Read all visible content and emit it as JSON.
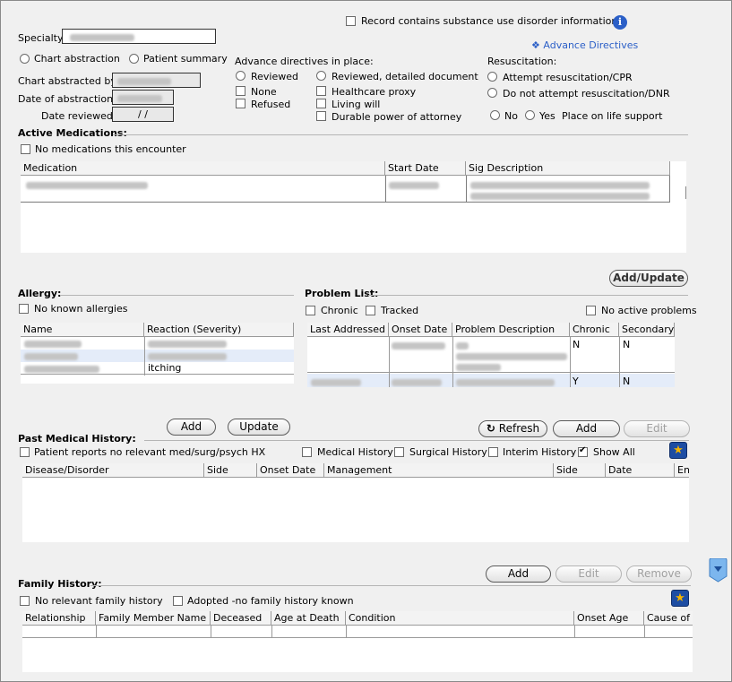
{
  "header": {
    "substance_use_label": "Record contains substance use disorder information",
    "advance_directives_link": "Advance Directives",
    "specialty_label": "Specialty:",
    "chart_abstraction_label": "Chart abstraction",
    "patient_summary_label": "Patient summary",
    "chart_abstracted_by_label": "Chart abstracted by:",
    "date_of_abstraction_label": "Date of abstraction:",
    "date_reviewed_label": "Date reviewed:",
    "date_reviewed_value": "/ /"
  },
  "advance_directives": {
    "title": "Advance directives in place:",
    "reviewed": "Reviewed",
    "reviewed_detailed": "Reviewed, detailed document",
    "none": "None",
    "refused": "Refused",
    "healthcare_proxy": "Healthcare proxy",
    "living_will": "Living will",
    "durable_poa": "Durable power of attorney"
  },
  "resuscitation": {
    "title": "Resuscitation:",
    "attempt": "Attempt resuscitation/CPR",
    "dnr": "Do not attempt resuscitation/DNR",
    "no": "No",
    "yes": "Yes",
    "life_support": "Place on life support"
  },
  "active_medications": {
    "title": "Active Medications:",
    "no_meds_label": "No medications this encounter",
    "columns": [
      "Medication",
      "Start Date",
      "Sig Description"
    ],
    "add_update_button": "Add/Update"
  },
  "allergy": {
    "title": "Allergy:",
    "no_known_label": "No known allergies",
    "columns": [
      "Name",
      "Reaction (Severity)"
    ],
    "row3_reaction": "itching"
  },
  "problem_list": {
    "title": "Problem List:",
    "chronic_label": "Chronic",
    "tracked_label": "Tracked",
    "no_active_label": "No active problems",
    "columns": [
      "Last Addressed",
      "Onset Date",
      "Problem Description",
      "Chronic",
      "Secondary"
    ],
    "rows": [
      {
        "chronic": "N",
        "secondary": "N"
      },
      {
        "chronic": "Y",
        "secondary": "N"
      }
    ]
  },
  "past_medical_history": {
    "add_button": "Add",
    "update_button": "Update",
    "refresh_button": "Refresh",
    "add2_button": "Add",
    "edit_button": "Edit",
    "title": "Past Medical History:",
    "no_relevant_label": "Patient reports no relevant med/surg/psych HX",
    "medical_history": "Medical History",
    "surgical_history": "Surgical History",
    "interim_history": "Interim History",
    "show_all": "Show All",
    "columns": [
      "Disease/Disorder",
      "Side",
      "Onset Date",
      "Management",
      "Side",
      "Date",
      "En"
    ]
  },
  "family_history": {
    "add_button": "Add",
    "edit_button": "Edit",
    "remove_button": "Remove",
    "title": "Family History:",
    "no_relevant_label": "No relevant family history",
    "adopted_label": "Adopted -no family history known",
    "columns": [
      "Relationship",
      "Family Member Name",
      "Deceased",
      "Age at Death",
      "Condition",
      "Onset Age",
      "Cause of D"
    ]
  },
  "icons": {
    "info": "info-icon",
    "star": "favorites-star-icon",
    "scroll": "scroll-down-icon",
    "refresh": "refresh-icon",
    "diamond": "diamond-bullet-icon"
  },
  "colors": {
    "link": "#2b5fc7",
    "accent": "#1d4da3",
    "disabled": "#a0a0a0",
    "scroll": "#4a90d9"
  }
}
